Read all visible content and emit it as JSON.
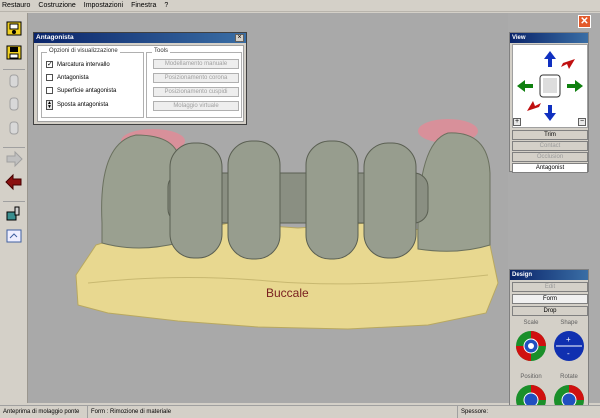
{
  "menu": [
    "Restauro",
    "Costruzione",
    "Impostazioni",
    "Finestra",
    "?"
  ],
  "antagonista": {
    "title": "Antagonista",
    "close": "×",
    "options_group": "Opzioni di visualizzazione",
    "options": [
      {
        "label": "Marcatura intervallo",
        "checked": "✓"
      },
      {
        "label": "Antagonista",
        "checked": ""
      },
      {
        "label": "Superficie antagonista",
        "checked": ""
      }
    ],
    "spin_label": "Sposta antagonista",
    "tools_group": "Tools",
    "tools": [
      "Modellamento manuale",
      "Posizionamento corona",
      "Posizionamento cuspidi",
      "Molaggio virtuale"
    ]
  },
  "view": {
    "title": "View",
    "buttons": {
      "trim": "Trim",
      "contact": "Contact",
      "occlusion": "Occlusion",
      "antagonist": "Antagonist"
    },
    "plus": "+",
    "minus": "−"
  },
  "design": {
    "title": "Design",
    "buttons": {
      "edit": "Edit",
      "form": "Form",
      "drop": "Drop"
    },
    "labels": {
      "scale": "Scale",
      "shape": "Shape",
      "position": "Position",
      "rotate": "Rotate"
    }
  },
  "viewport": {
    "caption": "Buccale"
  },
  "status": {
    "left": "Anteprima di molaggio ponte",
    "mid": "Form : Rimozione di materiale",
    "right": "Spessore:"
  },
  "window_close": "✕"
}
